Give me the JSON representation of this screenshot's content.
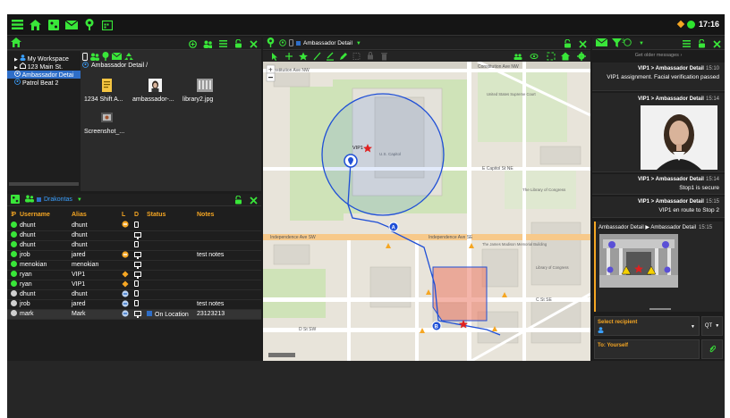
{
  "topbar": {
    "time": "17:16"
  },
  "workspace": {
    "tree": [
      {
        "label": "My Workspace",
        "selected": false
      },
      {
        "label": "123 Main St.",
        "selected": false
      },
      {
        "label": "Ambassador Detai",
        "selected": true
      },
      {
        "label": "Patrol Beat 2",
        "selected": false
      }
    ],
    "breadcrumb": "Ambassador Detail /",
    "files": [
      {
        "name": "1234 Shift A..."
      },
      {
        "name": "ambassador-..."
      },
      {
        "name": "library2.jpg"
      },
      {
        "name": "Screenshot_..."
      }
    ]
  },
  "users": {
    "title": "Drakontas",
    "columns": [
      "P",
      "Username",
      "Alias",
      "L",
      "D",
      "Status",
      "Notes"
    ],
    "rows": [
      {
        "username": "dhunt",
        "alias": "dhunt",
        "status": "",
        "notes": "",
        "presence": "#39e639",
        "loc": "orange-minus",
        "device": "phone"
      },
      {
        "username": "dhunt",
        "alias": "dhunt",
        "status": "",
        "notes": "",
        "presence": "#39e639",
        "loc": "",
        "device": "monitor"
      },
      {
        "username": "dhunt",
        "alias": "dhunt",
        "status": "",
        "notes": "",
        "presence": "#39e639",
        "loc": "",
        "device": "phone"
      },
      {
        "username": "jrob",
        "alias": "jared",
        "status": "",
        "notes": "test notes",
        "presence": "#39e639",
        "loc": "orange-minus",
        "device": "monitor"
      },
      {
        "username": "menokian",
        "alias": "menokian",
        "status": "",
        "notes": "",
        "presence": "#39e639",
        "loc": "",
        "device": "monitor"
      },
      {
        "username": "ryan",
        "alias": "VIP1",
        "status": "",
        "notes": "",
        "presence": "#39e639",
        "loc": "orange-diamond",
        "device": "monitor"
      },
      {
        "username": "ryan",
        "alias": "VIP1",
        "status": "",
        "notes": "",
        "presence": "#39e639",
        "loc": "orange-diamond",
        "device": "phone"
      },
      {
        "username": "dhunt",
        "alias": "dhunt",
        "status": "",
        "notes": "",
        "presence": "#d0d0d0",
        "loc": "blue-minus",
        "device": "phone"
      },
      {
        "username": "jrob",
        "alias": "jared",
        "status": "",
        "notes": "test notes",
        "presence": "#d0d0d0",
        "loc": "blue-minus",
        "device": "phone"
      },
      {
        "username": "mark",
        "alias": "Mark",
        "status": "On Location",
        "notes": "23123213",
        "presence": "#d0d0d0",
        "loc": "blue-minus",
        "device": "monitor"
      }
    ]
  },
  "map": {
    "title": "Ambassador Detail",
    "labels": {
      "vip": "VIP1",
      "marker_a": "A",
      "marker_b": "B",
      "street1": "Constitution Ave NW",
      "street2": "Independence Ave SW",
      "street3": "Independence Ave SE",
      "street4": "E Capitol St NE",
      "street5": "C St SE",
      "street6": "D St SW",
      "poi1": "U.S. Capitol",
      "poi2": "The Library of Congress",
      "poi3": "The James Madison Memorial Building",
      "poi4": "Library of Congress",
      "poi5": "United States Supreme Court"
    }
  },
  "chat": {
    "filter_count": "3",
    "older_link": "Get older messages",
    "messages": [
      {
        "from": "VIP1",
        "to": "Ambassador Detail",
        "time": "15:10",
        "text": "VIP1 assignment. Facial verification passed"
      },
      {
        "from": "VIP1",
        "to": "Ambassador Detail",
        "time": "15:14",
        "text": ""
      },
      {
        "from": "VIP1",
        "to": "Ambassador Detail",
        "time": "15:14",
        "text": "Stop1 is secure"
      },
      {
        "from": "VIP1",
        "to": "Ambassador Detail",
        "time": "15:15",
        "text": "VIP1 en route to Stop 2"
      }
    ],
    "alert": {
      "from": "Ambassador Detail",
      "to": "Ambassador Detail",
      "time": "15:15"
    },
    "recipient_label": "Select recipient",
    "qt_label": "QT",
    "to_label": "To: Yourself"
  },
  "colors": {
    "accent": "#39e639",
    "orange": "#f5a623",
    "route": "#1f4fd6",
    "select": "#2e6ec8"
  }
}
